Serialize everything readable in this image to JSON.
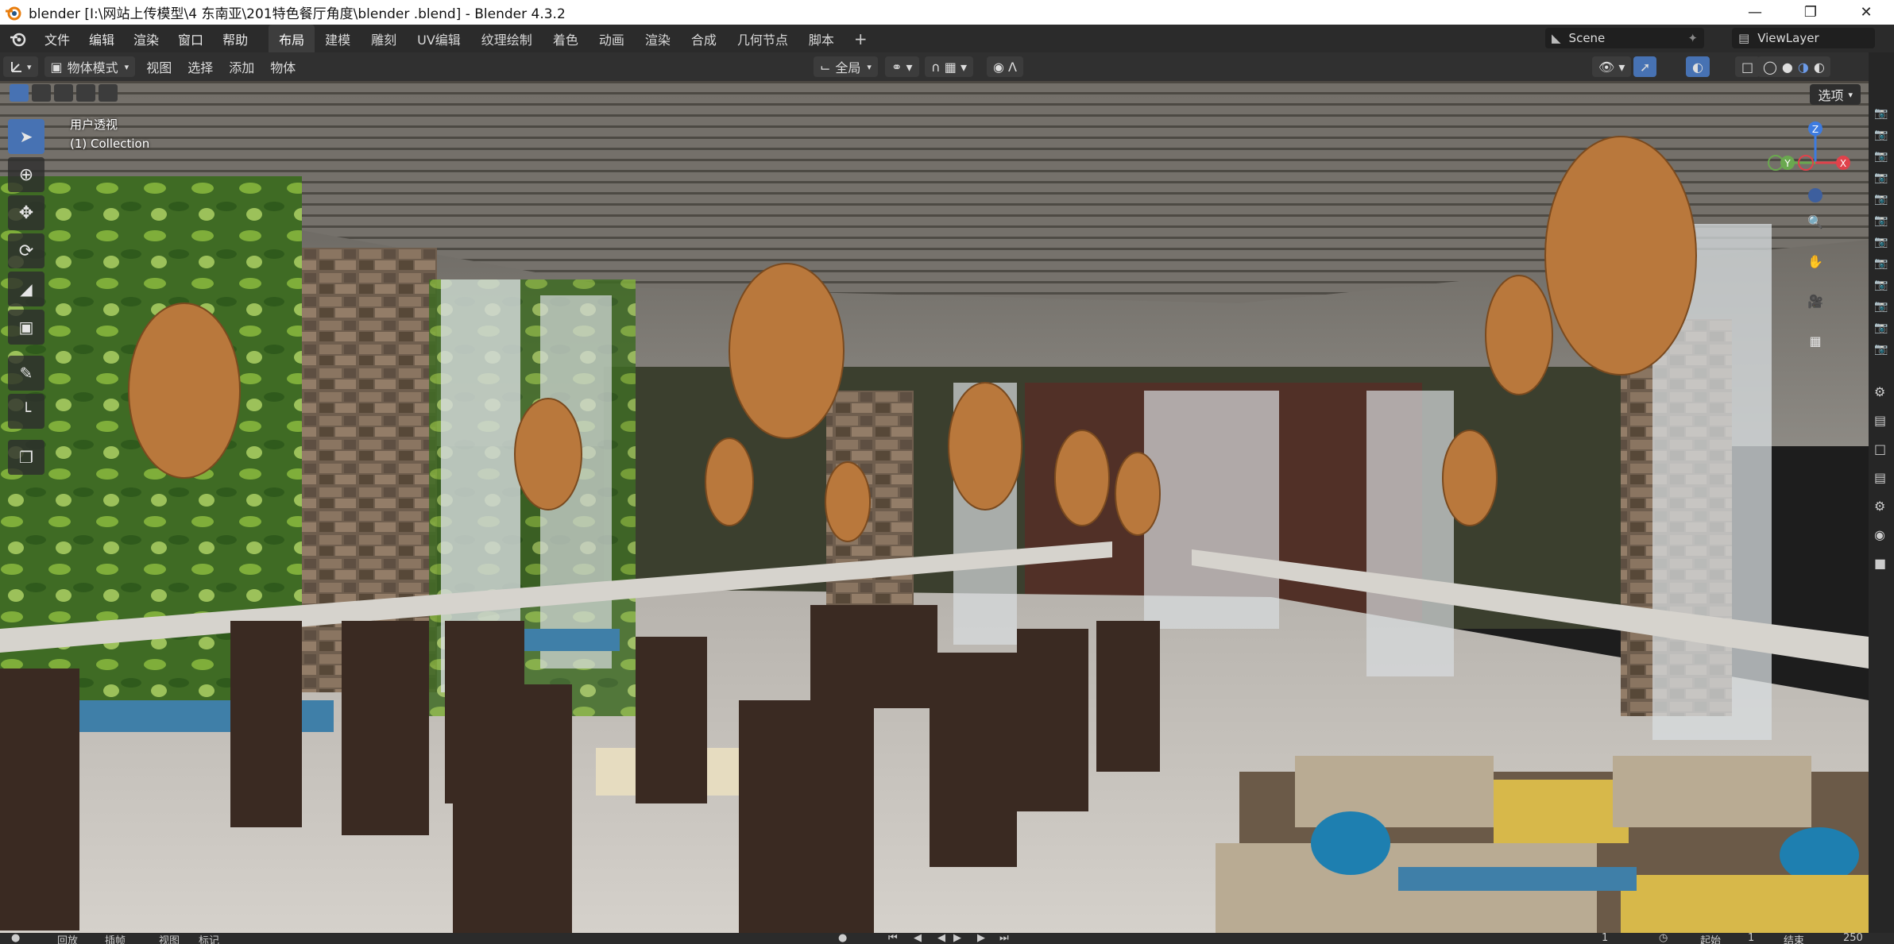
{
  "window": {
    "title": "blender  [I:\\网站上传模型\\4 东南亚\\201特色餐厅角度\\blender .blend] - Blender 4.3.2"
  },
  "menubar": {
    "menus": [
      "文件",
      "编辑",
      "渲染",
      "窗口",
      "帮助"
    ],
    "workspaces": [
      "布局",
      "建模",
      "雕刻",
      "UV编辑",
      "纹理绘制",
      "着色",
      "动画",
      "渲染",
      "合成",
      "几何节点",
      "脚本"
    ],
    "active_workspace": "布局",
    "scene": "Scene",
    "view_layer": "ViewLayer"
  },
  "header": {
    "mode": "物体模式",
    "menus": [
      "视图",
      "选择",
      "添加",
      "物体"
    ],
    "transform_orientation": "全局",
    "options_label": "选项"
  },
  "viewport": {
    "view_name": "用户透视",
    "collection": "(1) Collection",
    "gizmo_axes": [
      "Z",
      "Y",
      "X"
    ]
  },
  "statusbar": {
    "items": [
      "回放",
      "插帧",
      "视图",
      "标记"
    ],
    "current_frame": "1",
    "start_label": "起始",
    "start_frame": "1",
    "end_label": "结束",
    "end_frame": "250"
  },
  "colors": {
    "accent": "#4772b3",
    "x_axis": "#e0424b",
    "y_axis": "#6aa84f",
    "z_axis": "#3d7be0"
  }
}
